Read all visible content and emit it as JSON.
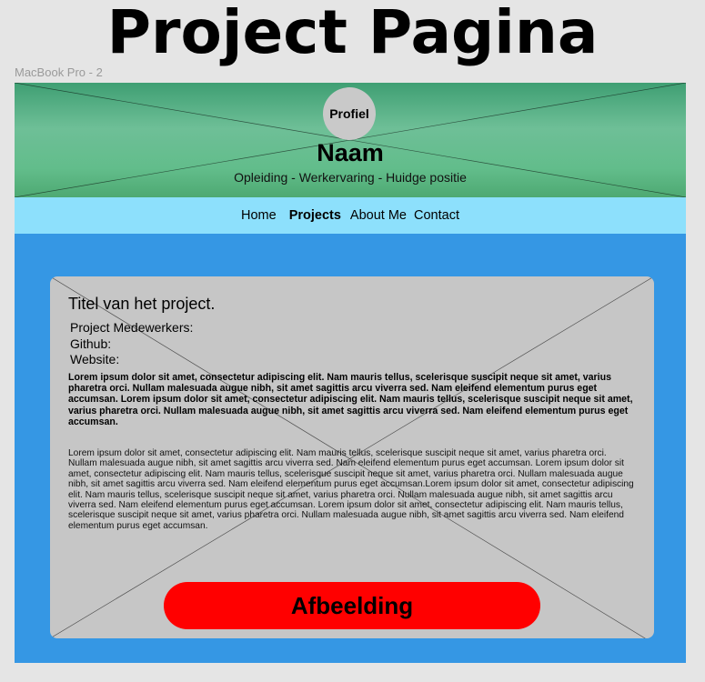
{
  "page_title": "Project Pagina",
  "frame_label": "MacBook Pro - 2",
  "header": {
    "avatar_label": "Profiel",
    "name": "Naam",
    "subtitle": "Opleiding - Werkervaring - Huidge positie"
  },
  "nav": {
    "items": [
      {
        "label": "Home",
        "active": false
      },
      {
        "label": "Projects",
        "active": true
      },
      {
        "label": "About Me",
        "active": false
      },
      {
        "label": "Contact",
        "active": false
      }
    ]
  },
  "card": {
    "title": "Titel van het project.",
    "collaborators_label": "Project Medewerkers:",
    "github_label": "Github:",
    "website_label": "Website:",
    "lead_text": "Lorem ipsum dolor sit amet, consectetur adipiscing elit. Nam mauris tellus, scelerisque suscipit neque sit amet, varius pharetra orci. Nullam malesuada augue nibh, sit amet sagittis arcu viverra sed. Nam eleifend elementum purus eget accumsan. Lorem ipsum dolor sit amet, consectetur adipiscing elit. Nam mauris tellus, scelerisque suscipit neque sit amet, varius pharetra orci. Nullam malesuada augue nibh, sit amet sagittis arcu viverra sed. Nam eleifend elementum purus eget accumsan.",
    "body_text": "Lorem ipsum dolor sit amet, consectetur adipiscing elit. Nam mauris tellus, scelerisque suscipit neque sit amet, varius pharetra orci. Nullam malesuada augue nibh, sit amet sagittis arcu viverra sed. Nam eleifend elementum purus eget accumsan. Lorem ipsum dolor sit amet, consectetur adipiscing elit. Nam mauris tellus, scelerisque suscipit neque sit amet, varius pharetra orci. Nullam malesuada augue nibh, sit amet sagittis arcu viverra sed. Nam eleifend elementum purus eget accumsan.Lorem ipsum dolor sit amet, consectetur adipiscing elit. Nam mauris tellus, scelerisque suscipit neque sit amet, varius pharetra orci. Nullam malesuada augue nibh, sit amet sagittis arcu viverra sed. Nam eleifend elementum purus eget accumsan. Lorem ipsum dolor sit amet, consectetur adipiscing elit. Nam mauris tellus, scelerisque suscipit neque sit amet, varius pharetra orci. Nullam malesuada augue nibh, sit amet sagittis arcu viverra sed. Nam eleifend elementum purus eget accumsan.",
    "image_button_label": "Afbeelding"
  },
  "colors": {
    "page_background": "#e5e5e5",
    "frame_background": "#3597e4",
    "header_green": "#62bd8b",
    "nav_background": "#8de0fc",
    "card_background": "#c6c6c6",
    "button_red": "#ff0000"
  }
}
